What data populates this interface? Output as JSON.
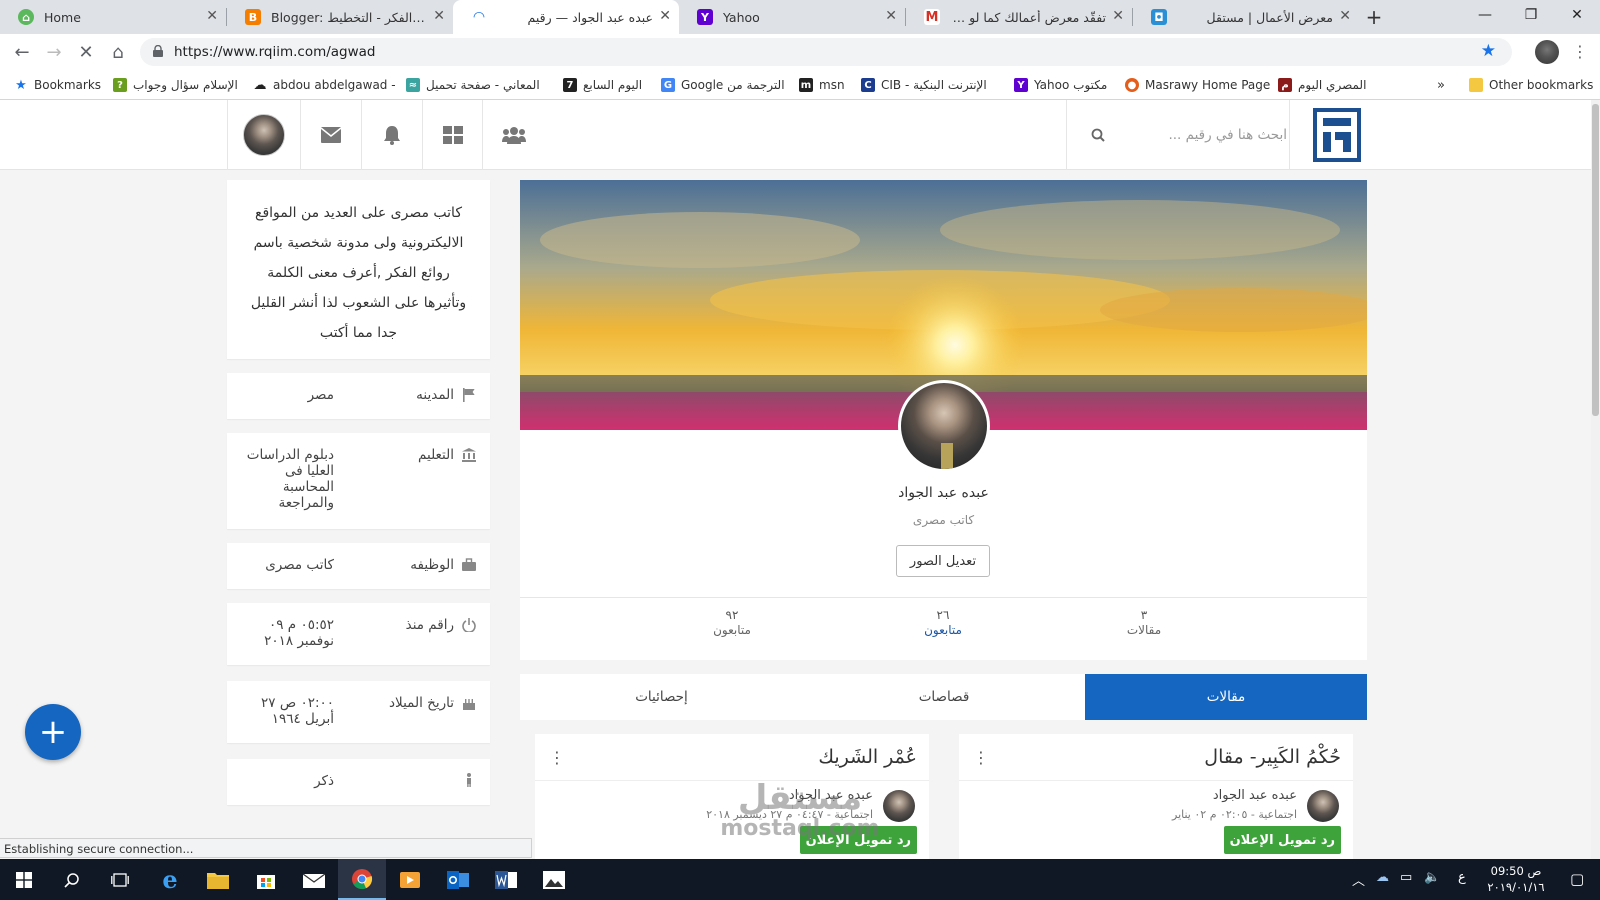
{
  "browser": {
    "tabs": [
      {
        "title": "Home",
        "icon": "home-tab-icon",
        "color": "#5cb85c",
        "dir": "ltr",
        "active": false
      },
      {
        "title": "Blogger: روائع الفكر - التخطيط",
        "icon": "blogger-icon",
        "color": "#f57d00",
        "dir": "ltr",
        "active": false
      },
      {
        "title": "عبده عبد الجواد — رقيم",
        "icon": "loading-icon",
        "color": "#1a73e8",
        "dir": "rtl",
        "active": true
      },
      {
        "title": "Yahoo",
        "icon": "yahoo-icon",
        "color": "#5f01d1",
        "dir": "ltr",
        "active": false
      },
      {
        "title": "تفقّد معرض أعمالك كما لو كنت",
        "icon": "gmail-icon",
        "color": "#d93025",
        "dir": "rtl",
        "active": false
      },
      {
        "title": "معرض الأعمال | مستقل",
        "icon": "mostaql-icon",
        "color": "#2a8fd4",
        "dir": "rtl",
        "active": false
      }
    ],
    "url": "https://www.rqiim.com/agwad",
    "status": "Establishing secure connection..."
  },
  "bookmarks": [
    {
      "label": "Bookmarks",
      "icon": "star-icon",
      "color": "#1a73e8"
    },
    {
      "label": "الإسلام سؤال وجواب",
      "icon": "islamqa-icon",
      "color": "#6a9e1f"
    },
    {
      "label": "abdou abdelgawad -",
      "icon": "cloud-icon",
      "color": "#222222"
    },
    {
      "label": "المعاني - صفحة تحميل",
      "icon": "almaany-icon",
      "color": "#3ba3a0"
    },
    {
      "label": "اليوم السابع",
      "icon": "youm7-icon",
      "color": "#222222"
    },
    {
      "label": "Google الترجمة من",
      "icon": "translate-icon",
      "color": "#4285f4"
    },
    {
      "label": "msn",
      "icon": "msn-icon",
      "color": "#222222"
    },
    {
      "label": "CIB - الإنترنت البنكية",
      "icon": "cib-icon",
      "color": "#1b3c8f"
    },
    {
      "label": "Yahoo مكتوب",
      "icon": "yahoo-icon",
      "color": "#5f01d1"
    },
    {
      "label": "Masrawy Home Page",
      "icon": "masrawy-icon",
      "color": "#e55d1a"
    },
    {
      "label": "المصري اليوم",
      "icon": "almasryalyoum-icon",
      "color": "#8b1a1a"
    },
    {
      "label": "Other bookmarks",
      "icon": "folder-icon",
      "color": "#f5c842"
    }
  ],
  "site": {
    "search_placeholder": "ابحث هنا في رقيم ...",
    "brand_color": "#1566c0"
  },
  "profile": {
    "bio": "كاتب مصرى على العديد من المواقع الاليكترونية ولى مدونة شخصية باسم روائع الفكر ,أعرف معنى الكلمة وتأثيرها على الشعوب لذا أنشر القليل جدا مما أكتب",
    "name": "عبده عبد الجواد",
    "title": "كاتب مصرى",
    "edit_photos": "تعديل الصور",
    "info": [
      {
        "label": "المدينه",
        "value": "مصر",
        "icon": "flag-icon"
      },
      {
        "label": "التعليم",
        "value": "دبلوم الدراسات العليا فى المحاسبة والمراجعة",
        "icon": "institution-icon"
      },
      {
        "label": "الوظيفه",
        "value": "كاتب مصرى",
        "icon": "briefcase-icon"
      },
      {
        "label": "راقم منذ",
        "value": "٠٥:٥٢ م ٠٩ نوفمبر ٢٠١٨",
        "icon": "power-icon"
      },
      {
        "label": "تاريخ الميلاد",
        "value": "٠٢:٠٠ ص ٢٧ أبريل ١٩٦٤",
        "icon": "birthday-cake-icon"
      },
      {
        "label": "",
        "value": "ذكر",
        "icon": "male-icon"
      }
    ],
    "stats": [
      {
        "num": "٣",
        "label": "مقالات"
      },
      {
        "num": "٢٦",
        "label": "متابعون"
      },
      {
        "num": "٩٢",
        "label": "متابعون"
      }
    ]
  },
  "tabs": [
    "مقالات",
    "قصاصات",
    "إحصائيات"
  ],
  "articles": [
    {
      "title": "حُكْمُ الكَبِير- مقال",
      "author": "عبده عبد الجواد",
      "category": "اجتماعية",
      "date": "٠٢:٠٥ م ٠٢ يناير",
      "badge": "رد تمويل الإعلان"
    },
    {
      "title": "عُمْر الشَريك",
      "author": "عبده عبد الجواد",
      "category": "اجتماعية",
      "date": "٠٤:٤٧ م ٢٧ ديسمبر ٢٠١٨",
      "badge": "رد تمويل الإعلان"
    }
  ],
  "watermark": {
    "line1": "مستقل",
    "line2": "mostaql.com"
  },
  "taskbar": {
    "time": "09:50 ص",
    "date": "٢٠١٩/٠١/١٦",
    "lang": "ع"
  }
}
